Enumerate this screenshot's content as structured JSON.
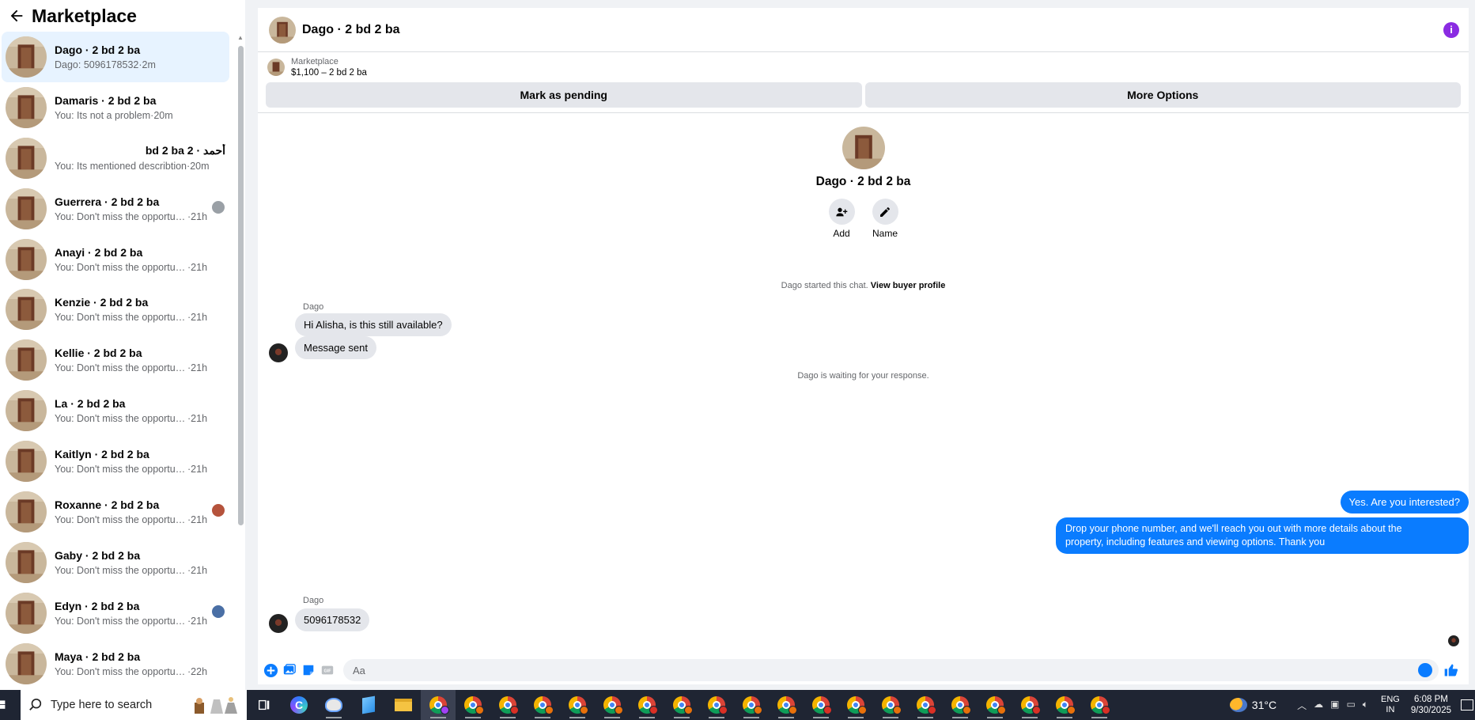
{
  "sidebar": {
    "title": "Marketplace",
    "conversations": [
      {
        "name": "Dago · 2 bd 2 ba",
        "snippet": "Dago: 5096178532",
        "time": "2m",
        "active": true,
        "rtl": false,
        "badge": ""
      },
      {
        "name": "Damaris · 2 bd 2 ba",
        "snippet": "You: Its not a problem",
        "time": "20m",
        "active": false,
        "rtl": false,
        "badge": ""
      },
      {
        "name": "أحمد · 2 bd 2 ba",
        "snippet": "You: Its mentioned describtion",
        "time": "20m",
        "active": false,
        "rtl": true,
        "badge": ""
      },
      {
        "name": "Guerrera · 2 bd 2 ba",
        "snippet": "You: Don't miss the opportunit...",
        "time": "21h",
        "active": false,
        "rtl": false,
        "badge": "#9aa0a6"
      },
      {
        "name": "Anayi · 2 bd 2 ba",
        "snippet": "You: Don't miss the opportunity a...",
        "time": "21h",
        "active": false,
        "rtl": false,
        "badge": ""
      },
      {
        "name": "Kenzie · 2 bd 2 ba",
        "snippet": "You: Don't miss the opportunity a...",
        "time": "21h",
        "active": false,
        "rtl": false,
        "badge": ""
      },
      {
        "name": "Kellie · 2 bd 2 ba",
        "snippet": "You: Don't miss the opportunity a...",
        "time": "21h",
        "active": false,
        "rtl": false,
        "badge": ""
      },
      {
        "name": "La · 2 bd 2 ba",
        "snippet": "You: Don't miss the opportunity a...",
        "time": "21h",
        "active": false,
        "rtl": false,
        "badge": ""
      },
      {
        "name": "Kaitlyn · 2 bd 2 ba",
        "snippet": "You: Don't miss the opportunity a...",
        "time": "21h",
        "active": false,
        "rtl": false,
        "badge": ""
      },
      {
        "name": "Roxanne · 2 bd 2 ba",
        "snippet": "You: Don't miss the opportunit...",
        "time": "21h",
        "active": false,
        "rtl": false,
        "badge": "#b5533c"
      },
      {
        "name": "Gaby · 2 bd 2 ba",
        "snippet": "You: Don't miss the opportunity a...",
        "time": "21h",
        "active": false,
        "rtl": false,
        "badge": ""
      },
      {
        "name": "Edyn · 2 bd 2 ba",
        "snippet": "You: Don't miss the opportunit...",
        "time": "21h",
        "active": false,
        "rtl": false,
        "badge": "#4a6fa5"
      },
      {
        "name": "Maya · 2 bd 2 ba",
        "snippet": "You: Don't miss the opportunity a...",
        "time": "22h",
        "active": false,
        "rtl": false,
        "badge": ""
      }
    ]
  },
  "chat": {
    "title": "Dago · 2 bd 2 ba",
    "listing_source": "Marketplace",
    "listing_title": "$1,100 – 2 bd 2 ba",
    "mark_pending": "Mark as pending",
    "more_options": "More Options",
    "profile_name": "Dago · 2 bd 2 ba",
    "add_label": "Add",
    "name_label": "Name",
    "started_text": "Dago started this chat.",
    "view_profile": "View buyer profile",
    "waiting_text": "Dago is waiting for your response.",
    "sender1": "Dago",
    "msg_in_1": "Hi Alisha, is this still available?",
    "msg_in_2": "Message sent",
    "msg_out_1": "Yes. Are you interested?",
    "msg_out_2_line1": "Drop your phone number, and we'll reach you out with more details about the",
    "msg_out_2_line2": "property, including features and viewing options.  Thank you",
    "sender2": "Dago",
    "msg_in_3": "5096178532",
    "composer_placeholder": "Aa"
  },
  "taskbar": {
    "search_placeholder": "Type here to search",
    "temperature": "31°C",
    "lang_line1": "ENG",
    "lang_line2": "IN",
    "time": "6:08 PM",
    "date": "9/30/2025",
    "chrome_profile_colors": [
      "#e8710a",
      "#e8710a",
      "#d93025",
      "#e8710a",
      "#e8710a",
      "#e8710a",
      "#d93025",
      "#e8710a",
      "#d93025",
      "#e8710a",
      "#e8710a",
      "#d93025",
      "#e8710a",
      "#e8710a",
      "#d93025",
      "#e8710a",
      "#e8710a",
      "#d93025",
      "#e8710a",
      "#d93025"
    ]
  },
  "colors": {
    "accent": "#0a7cff",
    "active_conversation": "#e7f3ff",
    "info": "#8a2be2"
  }
}
